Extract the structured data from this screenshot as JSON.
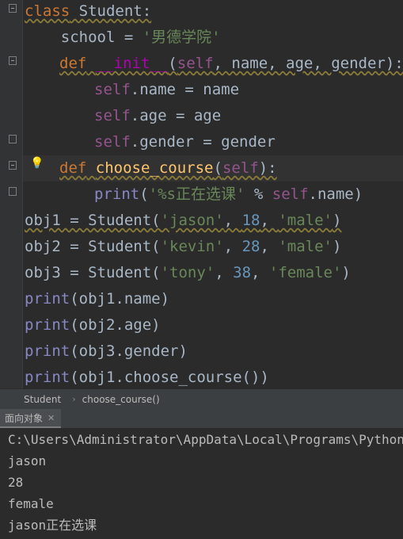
{
  "code": {
    "l1": {
      "kw": "class",
      "name": " Student:"
    },
    "l2": {
      "pre": "    school = ",
      "str": "'男德学院'"
    },
    "l3": {
      "kw": "def",
      "sp": " ",
      "fn": "__init__",
      "p1": "(",
      "self": "self",
      "rest": ", name, age, gender):"
    },
    "l4": {
      "self": "self",
      "rest": ".name = name"
    },
    "l5": {
      "self": "self",
      "rest": ".age = age"
    },
    "l6": {
      "self": "self",
      "rest": ".gender = gender"
    },
    "l7": {
      "kw": "def",
      "fn": "choose_course",
      "p1": "(",
      "self": "self",
      "p2": "):"
    },
    "l8": {
      "bi": "print",
      "p1": "(",
      "str": "'%s正在选课'",
      "p2": " % ",
      "self": "self",
      "p3": ".name)"
    },
    "l9": {
      "a": "obj1 = Student(",
      "s1": "'jason'",
      "c1": ", ",
      "n": "18",
      "c2": ", ",
      "s2": "'male'",
      "e": ")"
    },
    "l10": {
      "a": "obj2 = Student(",
      "s1": "'kevin'",
      "c1": ", ",
      "n": "28",
      "c2": ", ",
      "s2": "'male'",
      "e": ")"
    },
    "l11": {
      "a": "obj3 = Student(",
      "s1": "'tony'",
      "c1": ", ",
      "n": "38",
      "c2": ", ",
      "s2": "'female'",
      "e": ")"
    },
    "l12": {
      "bi": "print",
      "rest": "(obj1.name)"
    },
    "l13": {
      "bi": "print",
      "rest": "(obj2.age)"
    },
    "l14": {
      "bi": "print",
      "rest": "(obj3.gender)"
    },
    "l15": {
      "bi": "print",
      "rest": "(obj1.choose_course())"
    }
  },
  "breadcrumb": {
    "item1": "Student",
    "sep": "›",
    "item2": "choose_course()"
  },
  "run_tab": {
    "label": "面向对象",
    "close": "✕"
  },
  "console": {
    "lines": [
      "C:\\Users\\Administrator\\AppData\\Local\\Programs\\Python\\Pyt",
      "jason",
      "28",
      "female",
      "jason正在选课"
    ]
  },
  "icons": {
    "bulb": "💡"
  }
}
